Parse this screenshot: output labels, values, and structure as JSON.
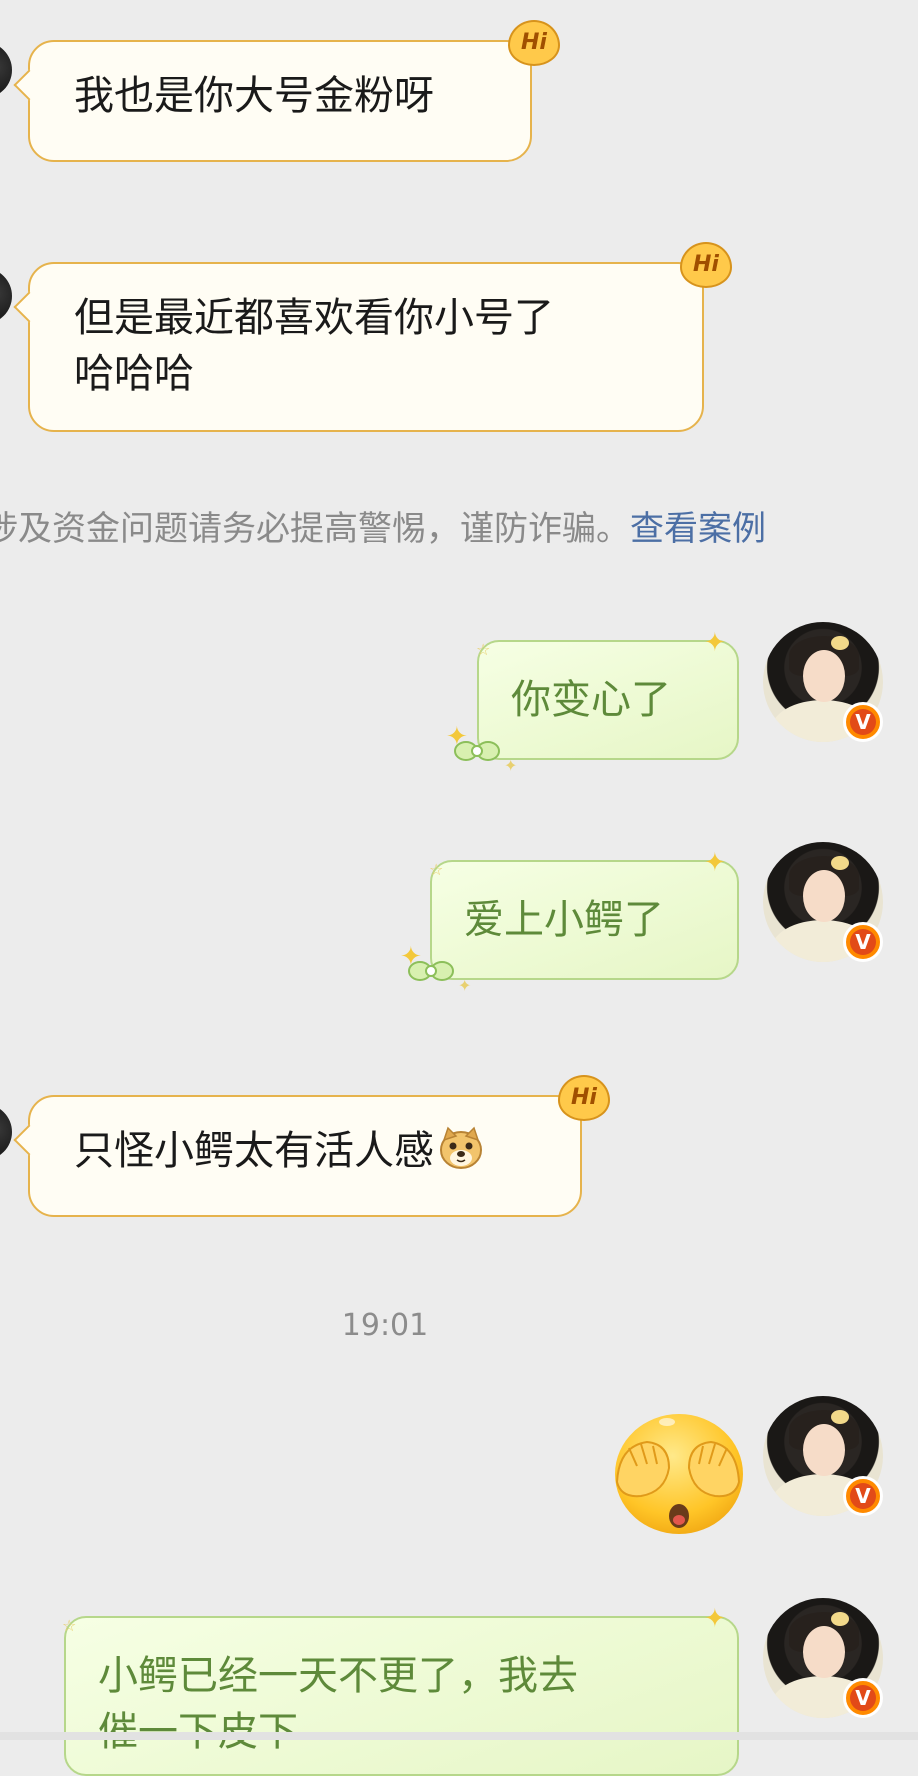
{
  "messages": {
    "m1": "我也是你大号金粉呀",
    "m2_line1": "但是最近都喜欢看你小号了",
    "m2_line2": "哈哈哈",
    "m3": "你变心了",
    "m4": "爱上小鳄了",
    "m5": "只怪小鳄太有活人感",
    "m7_line1": "小鳄已经一天不更了，我去",
    "m7_line2": "催一下皮下"
  },
  "badges": {
    "hi": "Hi",
    "verified": "V"
  },
  "notice": {
    "text": "涉及资金问题请务必提高警惕，谨防诈骗。",
    "link": "查看案例"
  },
  "timestamp": "19:01",
  "stickers": {
    "m5_emoji": "doge-face-icon",
    "m6_emoji": "cover-eyes-emoji-icon"
  },
  "colors": {
    "background": "#ececec",
    "incoming_bubble": "#fffdf4",
    "incoming_border": "#e6b34c",
    "outgoing_bubble": "#e6f6c6",
    "outgoing_border": "#b6d78a",
    "outgoing_text": "#5e8a3a",
    "link": "#4c6fa5",
    "verified_badge": "#ff8a00"
  }
}
